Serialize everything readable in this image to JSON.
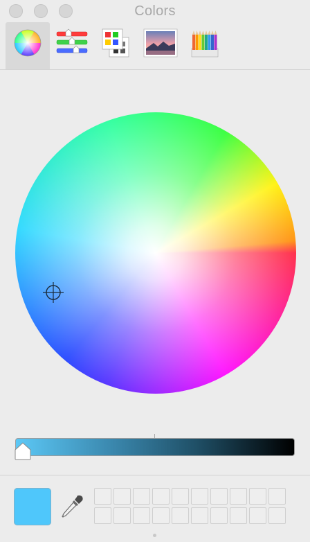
{
  "window": {
    "title": "Colors",
    "buttons": [
      "close",
      "minimize",
      "zoom"
    ]
  },
  "toolbar": {
    "selected": "color-wheel",
    "tools": [
      {
        "name": "color-wheel",
        "icon": "color-wheel-icon"
      },
      {
        "name": "color-sliders",
        "icon": "sliders-icon"
      },
      {
        "name": "color-palettes",
        "icon": "palette-icon"
      },
      {
        "name": "image-palettes",
        "icon": "image-icon"
      },
      {
        "name": "pencils",
        "icon": "pencils-icon"
      }
    ]
  },
  "color_wheel": {
    "selected_hue": "cyan-blue",
    "brightness_fraction": 1.0
  },
  "current_color": {
    "hex": "#4fc7fb"
  },
  "favorites": {
    "rows": 2,
    "columns": 10
  },
  "colors": {
    "background": "#ececec",
    "selected_tab_bg": "#d9d9d9",
    "swatch": "#4fc7fb"
  }
}
